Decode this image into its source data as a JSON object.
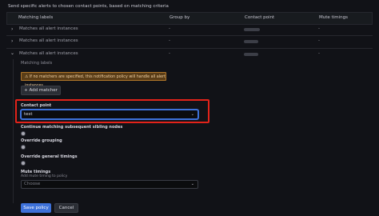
{
  "header": {
    "description": "Send specific alerts to chosen contact points, based on matching criteria"
  },
  "table": {
    "columns": [
      "Matching labels",
      "Group by",
      "Contact point",
      "Mute timings"
    ],
    "rows": [
      {
        "label": "Matches all alert instances",
        "group_by": "-",
        "mute": "-"
      },
      {
        "label": "Matches all alert instances",
        "group_by": "-",
        "mute": "-"
      },
      {
        "label": "Matches all alert instances",
        "group_by": "-",
        "mute": "-"
      }
    ]
  },
  "editor": {
    "matching_labels_title": "Matching labels",
    "warning": "If no matchers are specified, this notification policy will handle all alert instances.",
    "add_matcher": "Add matcher",
    "contact_point_label": "Contact point",
    "contact_point_value": "test",
    "continue_label": "Continue matching subsequent sibling nodes",
    "override_grouping_label": "Override grouping",
    "override_timings_label": "Override general timings",
    "mute_timings_label": "Mute timings",
    "mute_timings_desc": "Add mute timing to policy",
    "mute_timings_placeholder": "Choose"
  },
  "actions": {
    "save": "Save policy",
    "cancel": "Cancel"
  }
}
